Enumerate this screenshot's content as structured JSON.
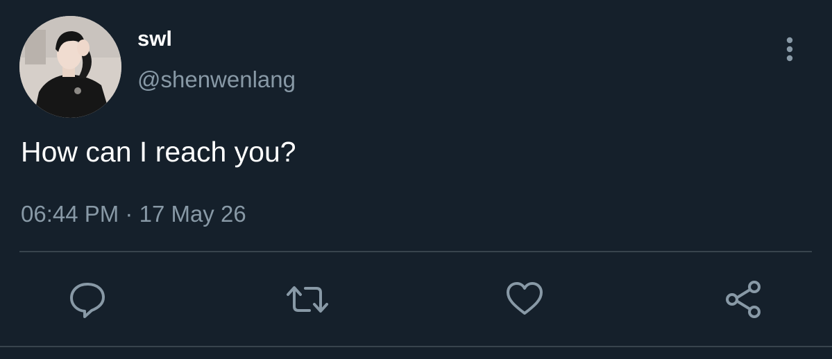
{
  "tweet": {
    "display_name": "swl",
    "handle": "@shenwenlang",
    "text": "How can I reach you?",
    "time": "06:44 PM",
    "separator": "·",
    "date": "17 May 26"
  },
  "icons": {
    "more": "more-vertical-icon",
    "reply": "reply-icon",
    "retweet": "retweet-icon",
    "like": "heart-icon",
    "share": "share-icon"
  },
  "colors": {
    "background": "#15202b",
    "primary_text": "#ffffff",
    "secondary_text": "#8899a6",
    "divider": "#38444d"
  }
}
